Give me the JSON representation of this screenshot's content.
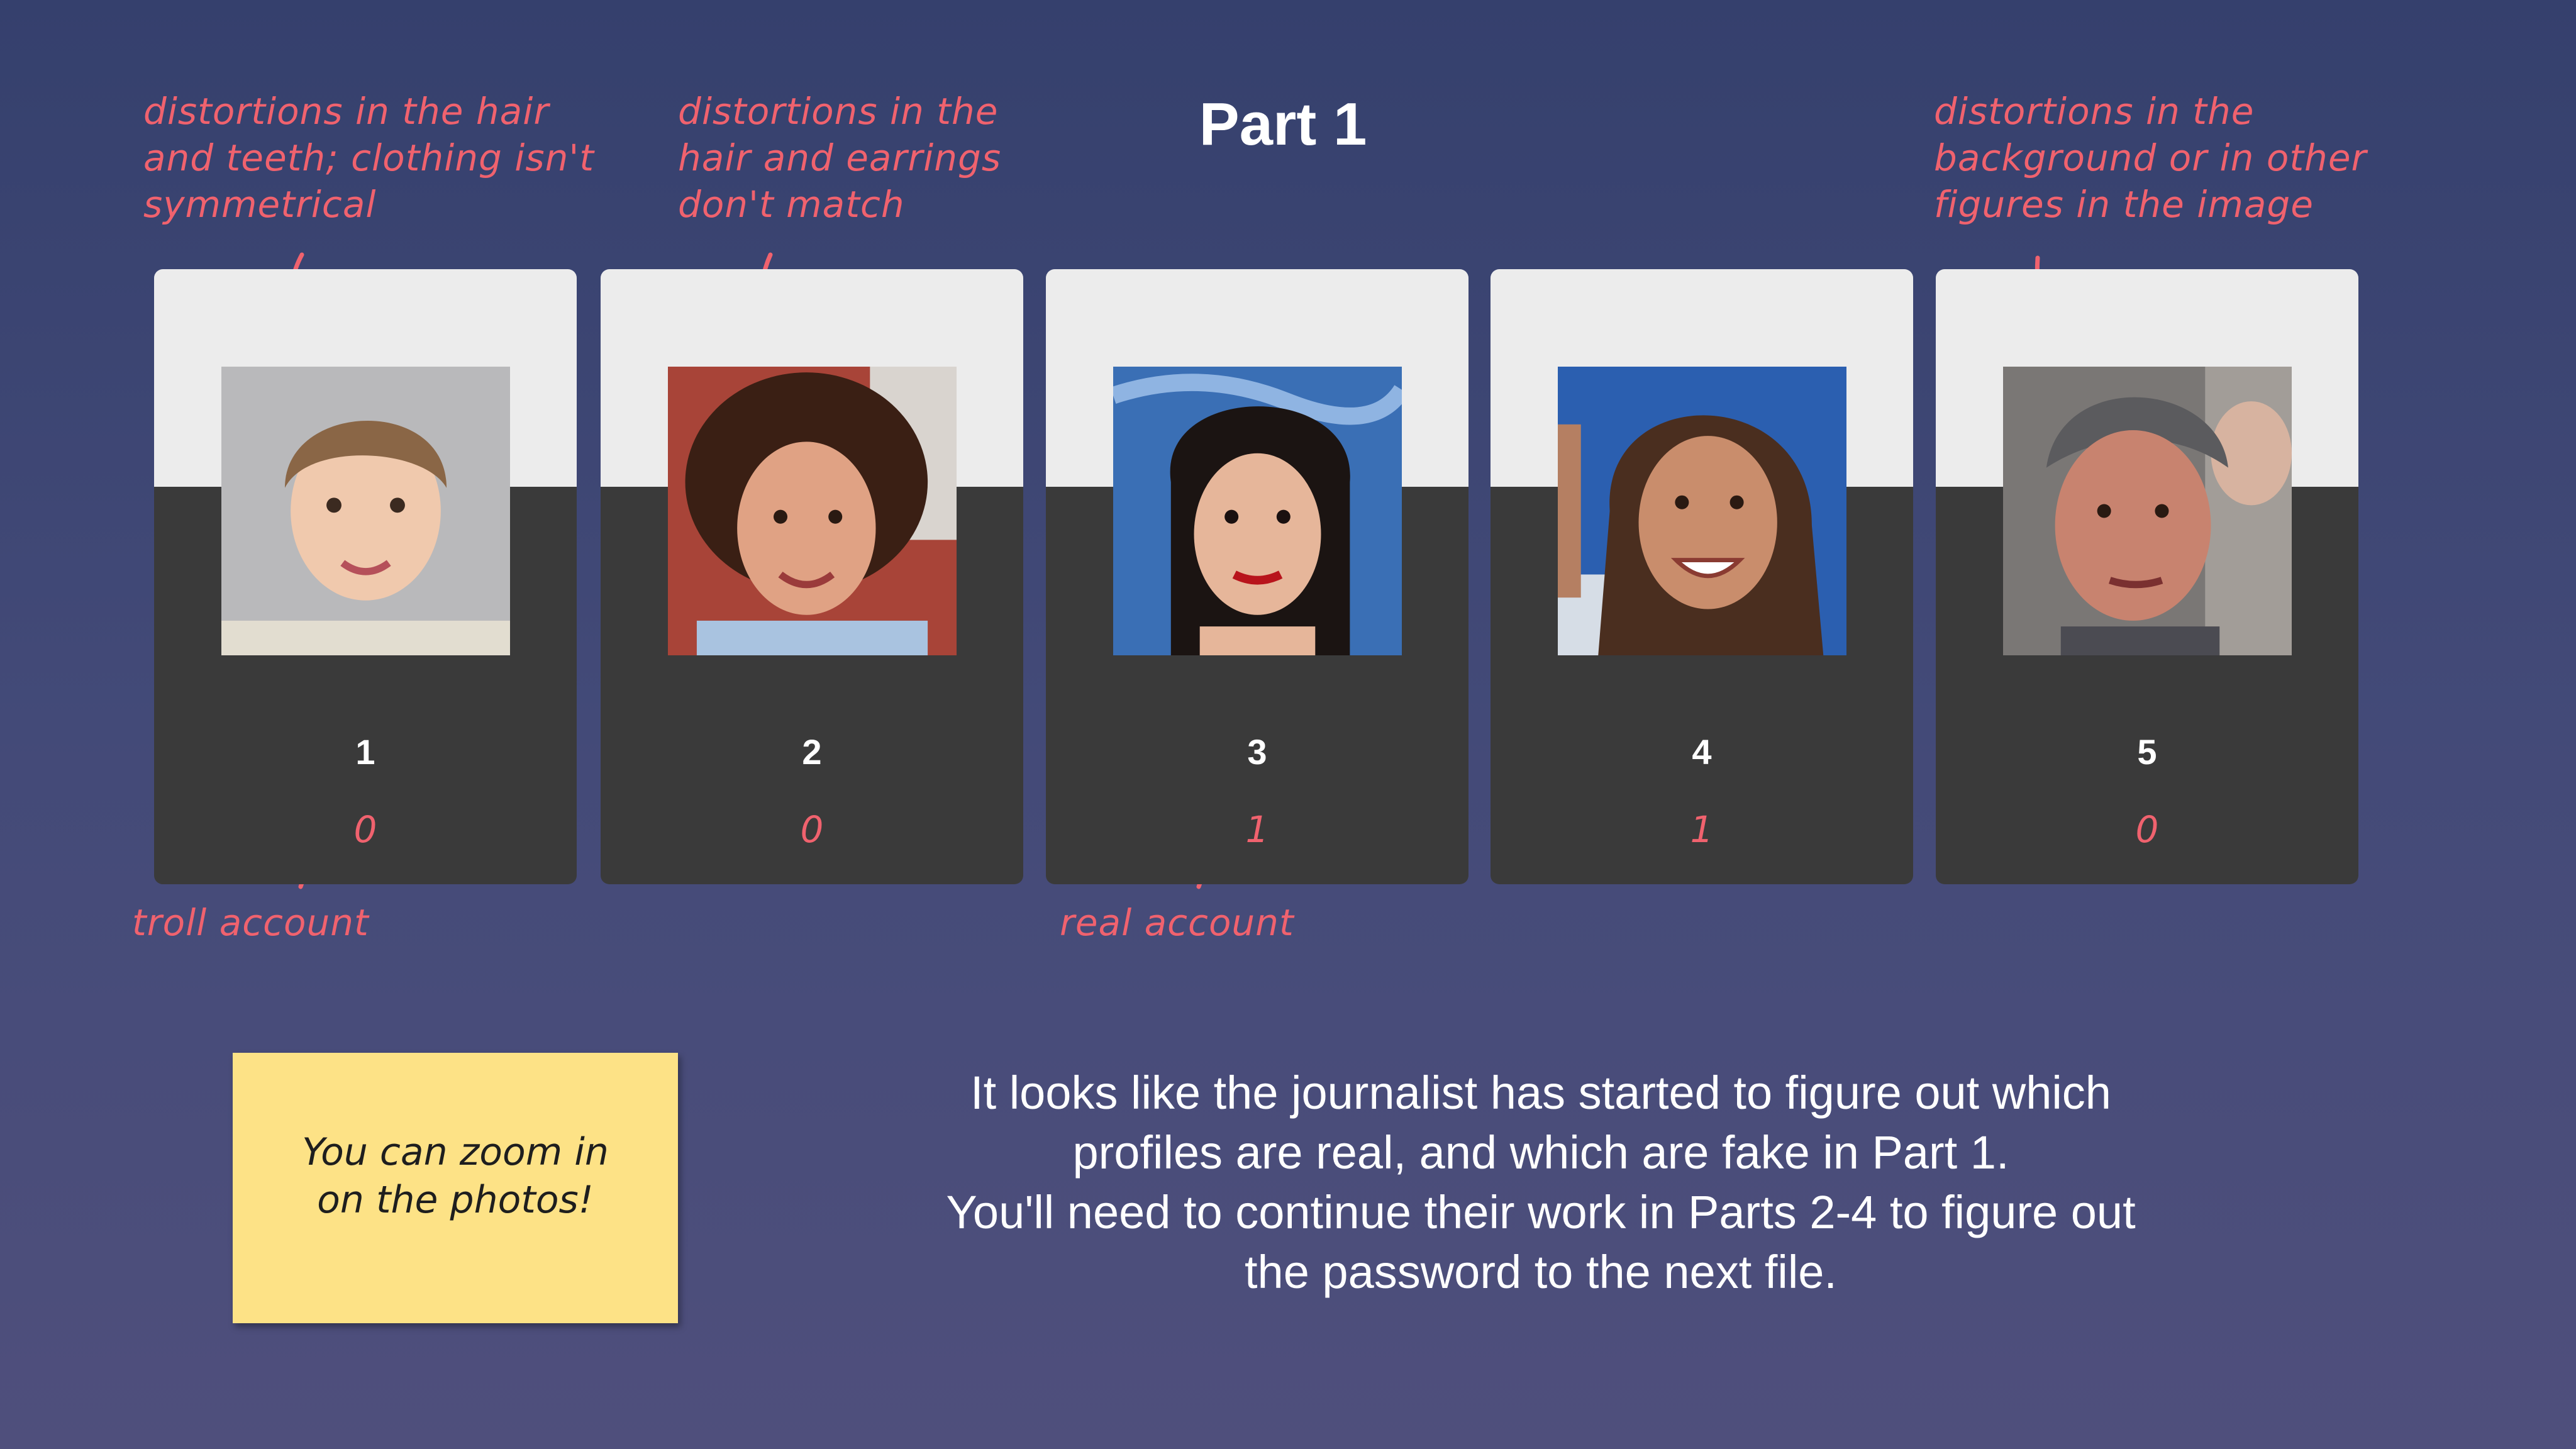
{
  "title": "Part 1",
  "annotations": {
    "card1_note": "distortions in the hair\nand teeth; clothing isn't\nsymmetrical",
    "card2_note": "distortions in the\nhair and earrings\ndon't match",
    "card5_note": "distortions in the\nbackground or in other\nfigures in the image",
    "troll": "troll account",
    "real": "real account"
  },
  "cards": [
    {
      "number": "1",
      "label": "0"
    },
    {
      "number": "2",
      "label": "0"
    },
    {
      "number": "3",
      "label": "1"
    },
    {
      "number": "4",
      "label": "1"
    },
    {
      "number": "5",
      "label": "0"
    }
  ],
  "sticky_note": "You can zoom in\non the photos!",
  "caption": "It looks like the journalist has started to figure out which profiles are real, and which are fake in Part 1.\nYou'll need to continue their work in Parts 2-4 to figure out the password to the next file.",
  "colors": {
    "annotation": "#f0626e",
    "card_top": "#ececec",
    "card_bottom": "#3a3a3a",
    "sticky": "#fde286"
  }
}
